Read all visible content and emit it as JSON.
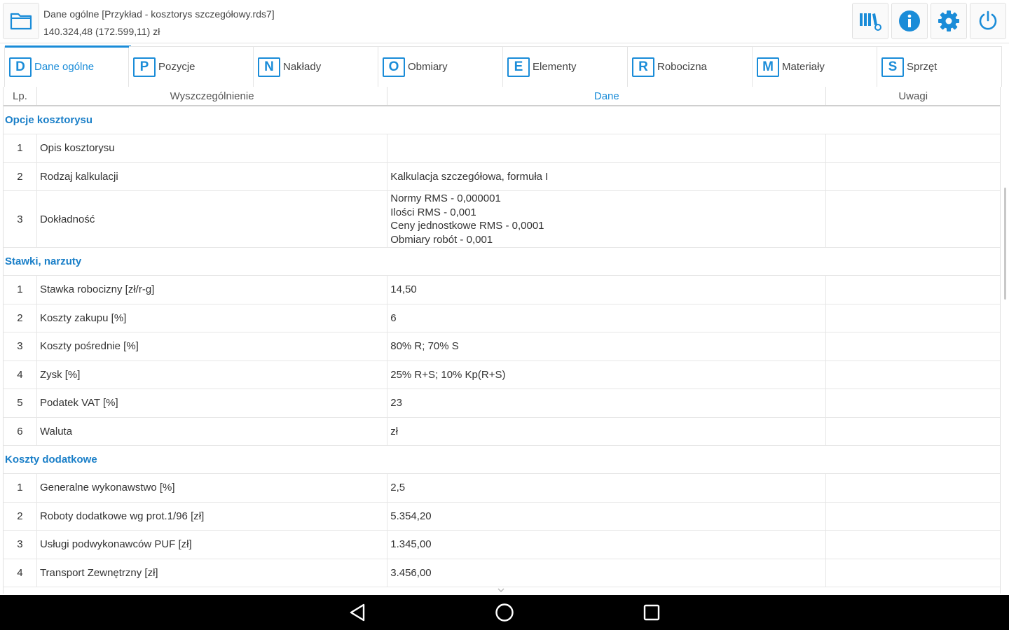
{
  "header": {
    "title": "Dane ogólne [Przykład - kosztorys szczegółowy.rds7]",
    "subtitle": "140.324,48 (172.599,11) zł",
    "folder_icon": "folder-icon",
    "actions": [
      {
        "icon": "library-settings-icon"
      },
      {
        "icon": "info-icon"
      },
      {
        "icon": "gear-icon"
      },
      {
        "icon": "power-icon"
      }
    ]
  },
  "tabs": [
    {
      "key": "D",
      "label": "Dane ogólne",
      "active": true
    },
    {
      "key": "P",
      "label": "Pozycje",
      "active": false
    },
    {
      "key": "N",
      "label": "Nakłady",
      "active": false
    },
    {
      "key": "O",
      "label": "Obmiary",
      "active": false
    },
    {
      "key": "E",
      "label": "Elementy",
      "active": false
    },
    {
      "key": "R",
      "label": "Robocizna",
      "active": false
    },
    {
      "key": "M",
      "label": "Materiały",
      "active": false
    },
    {
      "key": "S",
      "label": "Sprzęt",
      "active": false
    }
  ],
  "table": {
    "columns": {
      "lp": "Lp.",
      "desc": "Wyszczególnienie",
      "data": "Dane",
      "notes": "Uwagi"
    },
    "sections": [
      {
        "title": "Opcje kosztorysu",
        "rows": [
          {
            "lp": "1",
            "desc": "Opis kosztorysu",
            "data": [
              ""
            ],
            "notes": ""
          },
          {
            "lp": "2",
            "desc": "Rodzaj kalkulacji",
            "data": [
              "Kalkulacja szczegółowa, formuła I"
            ],
            "notes": ""
          },
          {
            "lp": "3",
            "desc": "Dokładność",
            "data": [
              "Normy RMS - 0,000001",
              "Ilości RMS - 0,001",
              "Ceny jednostkowe RMS - 0,0001",
              "Obmiary robót - 0,001"
            ],
            "notes": ""
          }
        ]
      },
      {
        "title": "Stawki, narzuty",
        "rows": [
          {
            "lp": "1",
            "desc": "Stawka robocizny [zł/r-g]",
            "data": [
              "14,50"
            ],
            "notes": ""
          },
          {
            "lp": "2",
            "desc": "Koszty zakupu [%]",
            "data": [
              "6"
            ],
            "notes": ""
          },
          {
            "lp": "3",
            "desc": "Koszty pośrednie [%]",
            "data": [
              "80% R; 70% S"
            ],
            "notes": ""
          },
          {
            "lp": "4",
            "desc": "Zysk [%]",
            "data": [
              "25% R+S; 10% Kp(R+S)"
            ],
            "notes": ""
          },
          {
            "lp": "5",
            "desc": "Podatek VAT [%]",
            "data": [
              "23"
            ],
            "notes": ""
          },
          {
            "lp": "6",
            "desc": "Waluta",
            "data": [
              "zł"
            ],
            "notes": ""
          }
        ]
      },
      {
        "title": "Koszty dodatkowe",
        "rows": [
          {
            "lp": "1",
            "desc": "Generalne wykonawstwo [%]",
            "data": [
              "2,5"
            ],
            "notes": ""
          },
          {
            "lp": "2",
            "desc": "Roboty dodatkowe wg prot.1/96 [zł]",
            "data": [
              "5.354,20"
            ],
            "notes": ""
          },
          {
            "lp": "3",
            "desc": "Usługi podwykonawców PUF [zł]",
            "data": [
              "1.345,00"
            ],
            "notes": ""
          },
          {
            "lp": "4",
            "desc": "Transport Zewnętrzny [zł]",
            "data": [
              "3.456,00"
            ],
            "notes": ""
          }
        ]
      }
    ]
  },
  "navbar": {
    "buttons": [
      {
        "icon": "back-icon"
      },
      {
        "icon": "home-icon"
      },
      {
        "icon": "recents-icon"
      }
    ]
  }
}
